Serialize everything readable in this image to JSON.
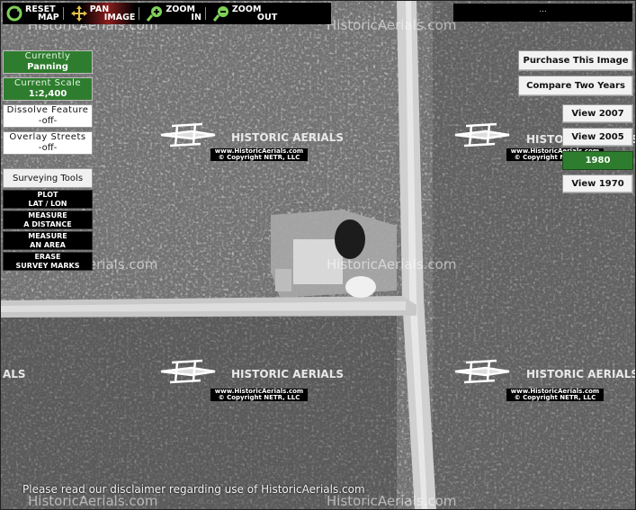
{
  "toolbar": {
    "reset": [
      "RESET",
      "MAP"
    ],
    "pan": [
      "PAN",
      "IMAGE"
    ],
    "zoom_in": [
      "ZOOM",
      "IN"
    ],
    "zoom_out": [
      "ZOOM",
      "OUT"
    ],
    "right_box": "..."
  },
  "left_panel": {
    "currently_label": "Currently",
    "currently_value": "Panning",
    "scale_label": "Current Scale",
    "scale_value": "1:2,400",
    "dissolve_label": "Dissolve Feature",
    "dissolve_value": "-off-",
    "overlay_label": "Overlay Streets",
    "overlay_value": "-off-",
    "surveying_label": "Surveying Tools",
    "tools": [
      [
        "PLOT",
        "LAT / LON"
      ],
      [
        "MEASURE",
        "A DISTANCE"
      ],
      [
        "MEASURE",
        "AN AREA"
      ],
      [
        "ERASE",
        "SURVEY MARKS"
      ]
    ]
  },
  "right_panel": {
    "purchase": "Purchase This Image",
    "compare": "Compare Two Years",
    "years": [
      "View 2007",
      "View 2005",
      "1980",
      "View 1970"
    ],
    "selected_year": "1980"
  },
  "watermark": {
    "brand": "HISTORIC AERIALS",
    "url": "www.HistoricAerials.com",
    "copyright": "© Copyright NETR, LLC",
    "site": "HistoricAerials.com"
  },
  "disclaimer": "Please read our disclaimer regarding use of HistoricAerials.com",
  "colors": {
    "panel_green": "#2e7d2e",
    "toolbar_black": "#000000"
  }
}
